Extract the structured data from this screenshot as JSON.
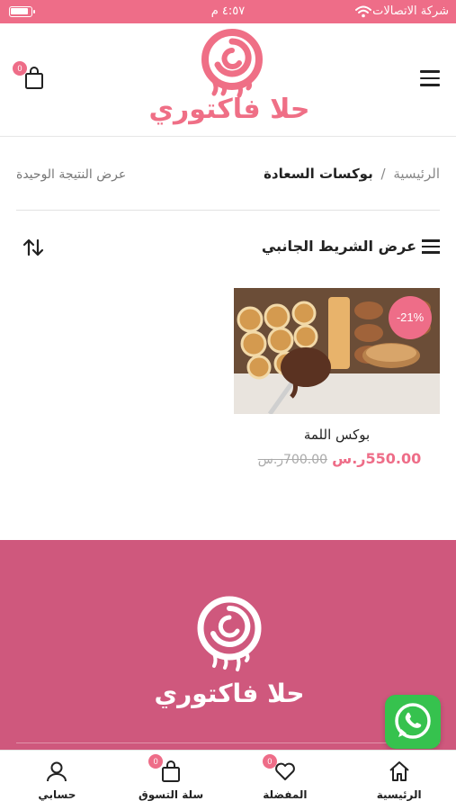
{
  "status_bar": {
    "carrier": "شركة الاتصالات",
    "time": "٤:٥٧ م"
  },
  "header": {
    "logo_text": "حلا فاكتوري",
    "cart_count": "0",
    "brand_color": "#ee6d88"
  },
  "breadcrumb": {
    "home": "الرئيسية",
    "separator": "/",
    "current": "بوكسات السعادة"
  },
  "result_count": "عرض النتيجة الوحيدة",
  "toolbar": {
    "sidebar_toggle": "عرض الشريط الجانبي"
  },
  "product": {
    "title": "بوكس اللمة",
    "sale_badge": "-21%",
    "old_price": "700.00ر.س",
    "new_price": "550.00ر.س"
  },
  "footer": {
    "logo_text": "حلا فاكتوري",
    "background": "#cf587d"
  },
  "bottom_nav": {
    "items": [
      {
        "label": "الرئيسية",
        "icon": "home-icon"
      },
      {
        "label": "المفضلة",
        "icon": "heart-icon",
        "badge": "0"
      },
      {
        "label": "سلة التسوق",
        "icon": "shopping-bag-icon",
        "badge": "0"
      },
      {
        "label": "حسابي",
        "icon": "user-icon"
      }
    ]
  }
}
